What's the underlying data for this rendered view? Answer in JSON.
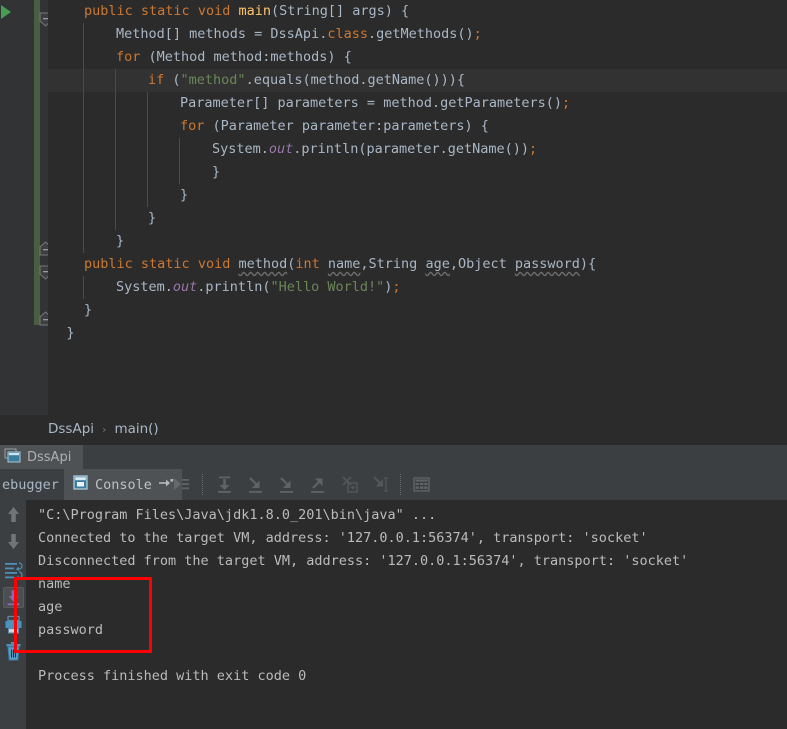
{
  "editor": {
    "lines": [
      {
        "indent": 0,
        "caret": false,
        "tokens": [
          {
            "t": "public ",
            "c": "kw"
          },
          {
            "t": "static ",
            "c": "kw"
          },
          {
            "t": "void ",
            "c": "kw"
          },
          {
            "t": "main",
            "c": "mth"
          },
          {
            "t": "(String[] args) {",
            "c": "plain"
          }
        ]
      },
      {
        "indent": 1,
        "caret": false,
        "tokens": [
          {
            "t": "Method[] methods = DssApi.",
            "c": "plain"
          },
          {
            "t": "class",
            "c": "kw"
          },
          {
            "t": ".getMethods()",
            "c": "plain"
          },
          {
            "t": ";",
            "c": "semi"
          }
        ]
      },
      {
        "indent": 1,
        "caret": false,
        "tokens": [
          {
            "t": "for ",
            "c": "kw"
          },
          {
            "t": "(Method method:methods) {",
            "c": "plain"
          }
        ]
      },
      {
        "indent": 2,
        "caret": true,
        "tokens": [
          {
            "t": "if ",
            "c": "kw"
          },
          {
            "t": "(",
            "c": "plain"
          },
          {
            "t": "\"method\"",
            "c": "str"
          },
          {
            "t": ".equals(method.getName())){",
            "c": "plain"
          }
        ]
      },
      {
        "indent": 3,
        "caret": false,
        "tokens": [
          {
            "t": "Parameter[] parameters = method.getParameters()",
            "c": "plain"
          },
          {
            "t": ";",
            "c": "semi"
          }
        ]
      },
      {
        "indent": 3,
        "caret": false,
        "tokens": [
          {
            "t": "for ",
            "c": "kw"
          },
          {
            "t": "(Parameter parameter:parameters) {",
            "c": "plain"
          }
        ]
      },
      {
        "indent": 4,
        "caret": false,
        "tokens": [
          {
            "t": "System.",
            "c": "plain"
          },
          {
            "t": "out",
            "c": "fld"
          },
          {
            "t": ".println(parameter.getName())",
            "c": "plain"
          },
          {
            "t": ";",
            "c": "semi"
          }
        ]
      },
      {
        "indent": 4,
        "caret": false,
        "tokens": [
          {
            "t": "}",
            "c": "plain"
          }
        ]
      },
      {
        "indent": 3,
        "caret": false,
        "tokens": [
          {
            "t": "}",
            "c": "plain"
          }
        ]
      },
      {
        "indent": 2,
        "caret": false,
        "tokens": [
          {
            "t": "}",
            "c": "plain"
          }
        ]
      },
      {
        "indent": 1,
        "caret": false,
        "tokens": [
          {
            "t": "}",
            "c": "plain"
          }
        ]
      },
      {
        "indent": 0,
        "caret": false,
        "tokens": [
          {
            "t": "public ",
            "c": "kw"
          },
          {
            "t": "static ",
            "c": "kw"
          },
          {
            "t": "void ",
            "c": "kw"
          },
          {
            "t": "method",
            "c": "plain warn"
          },
          {
            "t": "(",
            "c": "plain"
          },
          {
            "t": "int ",
            "c": "kw"
          },
          {
            "t": "name",
            "c": "plain warn"
          },
          {
            "t": ",String ",
            "c": "plain"
          },
          {
            "t": "age",
            "c": "plain warn"
          },
          {
            "t": ",Object ",
            "c": "plain"
          },
          {
            "t": "password",
            "c": "plain warn"
          },
          {
            "t": "){",
            "c": "plain"
          }
        ]
      },
      {
        "indent": 1,
        "caret": false,
        "tokens": [
          {
            "t": "System.",
            "c": "plain"
          },
          {
            "t": "out",
            "c": "fld"
          },
          {
            "t": ".println(",
            "c": "plain"
          },
          {
            "t": "\"Hello World!\"",
            "c": "str"
          },
          {
            "t": ")",
            "c": "plain"
          },
          {
            "t": ";",
            "c": "semi"
          }
        ]
      },
      {
        "indent": 0,
        "caret": false,
        "tokens": [
          {
            "t": "}",
            "c": "plain"
          }
        ]
      },
      {
        "indent": -1,
        "caret": false,
        "tokens": [
          {
            "t": "}",
            "c": "plain"
          }
        ]
      }
    ]
  },
  "breadcrumb": {
    "class_name": "DssApi",
    "separator": "›",
    "method_name": "main()"
  },
  "run_tab": {
    "label": "DssApi",
    "icon": "console-window-icon"
  },
  "tool_tabs": {
    "debugger_label": "ebugger",
    "console_label": "Console",
    "console_icon": "console-window-icon",
    "pin_icon": "pin-tab-icon"
  },
  "debug_toolbar": [
    {
      "name": "rerun-program-button",
      "icon": "rerun-icon"
    },
    {
      "name": "step-over-button",
      "icon": "step-over-icon"
    },
    {
      "name": "step-into-button",
      "icon": "step-into-icon"
    },
    {
      "name": "force-step-into-button",
      "icon": "force-step-into-icon"
    },
    {
      "name": "step-out-button",
      "icon": "step-out-icon"
    },
    {
      "name": "drop-frame-button",
      "icon": "drop-frame-icon"
    },
    {
      "name": "run-to-cursor-button",
      "icon": "run-to-cursor-icon"
    },
    {
      "name": "evaluate-expression-button",
      "icon": "evaluate-expression-icon"
    }
  ],
  "console_side_toolbar": [
    {
      "name": "scroll-up-button",
      "icon": "arrow-up-icon"
    },
    {
      "name": "scroll-down-button",
      "icon": "arrow-down-icon"
    },
    {
      "name": "soft-wrap-button",
      "icon": "soft-wrap-icon"
    },
    {
      "name": "scroll-to-end-button",
      "icon": "scroll-to-end-icon",
      "active": true
    },
    {
      "name": "print-button",
      "icon": "printer-icon"
    },
    {
      "name": "clear-all-button",
      "icon": "trash-icon"
    }
  ],
  "console": {
    "lines": [
      {
        "text": "\"C:\\Program Files\\Java\\jdk1.8.0_201\\bin\\java\" ...",
        "highlight": true
      },
      {
        "text": "Connected to the target VM, address: '127.0.0.1:56374', transport: 'socket'",
        "highlight": false
      },
      {
        "text": "Disconnected from the target VM, address: '127.0.0.1:56374', transport: 'socket'",
        "highlight": false
      },
      {
        "text": "name",
        "highlight": false
      },
      {
        "text": "age",
        "highlight": false
      },
      {
        "text": "password",
        "highlight": false
      },
      {
        "text": "",
        "highlight": false
      },
      {
        "text": "Process finished with exit code 0",
        "highlight": false
      }
    ]
  },
  "annotation": {
    "name": "red-highlight-box",
    "color": "#fe0000"
  },
  "gutter": {
    "run_arrow_icon": "run-gutter-arrow-icon",
    "change_bar_color": "#4a5e42",
    "fold_icon": "fold-collapse-icon"
  }
}
